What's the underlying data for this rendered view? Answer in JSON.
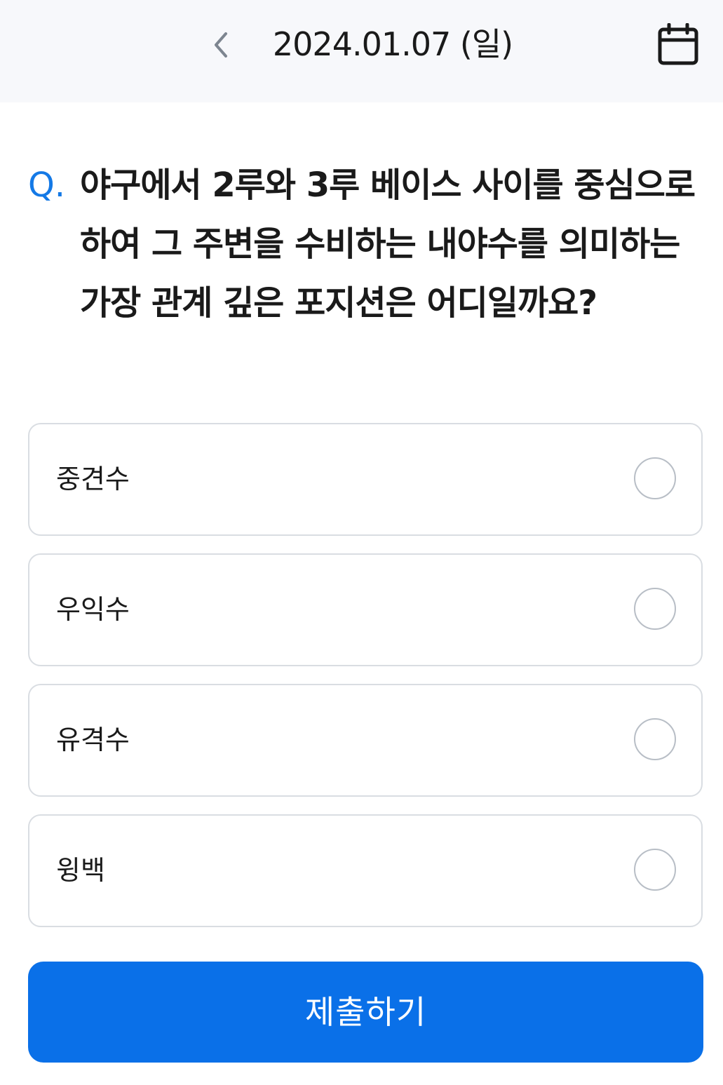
{
  "header": {
    "date": "2024.01.07 (일)",
    "back_icon": "chevron-left-icon",
    "calendar_icon": "calendar-icon"
  },
  "question": {
    "prefix": "Q.",
    "text": "야구에서 2루와 3루 베이스 사이를 중심으로 하여 그 주변을 수비하는 내야수를 의미하는 가장 관계 깊은 포지션은 어디일까요?"
  },
  "options": [
    {
      "label": "중견수",
      "selected": false
    },
    {
      "label": "우익수",
      "selected": false
    },
    {
      "label": "유격수",
      "selected": false
    },
    {
      "label": "윙백",
      "selected": false
    }
  ],
  "submit": {
    "label": "제출하기"
  },
  "colors": {
    "accent": "#0a70e8",
    "prefix": "#1479e6",
    "header_bg": "#f7f8fb",
    "border": "#d9dde2"
  }
}
